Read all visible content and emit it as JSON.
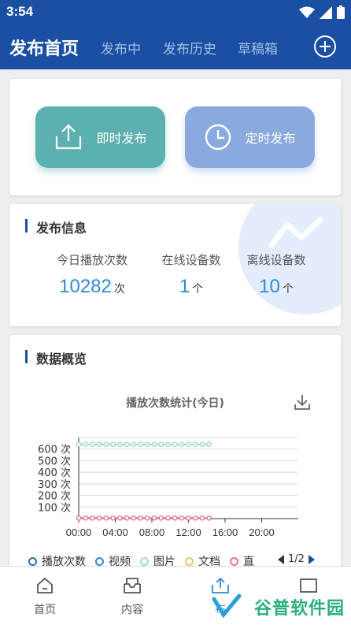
{
  "status_bar": {
    "time": "3:54"
  },
  "app_bar": {
    "title": "发布首页",
    "tabs": [
      {
        "label": "发布中"
      },
      {
        "label": "发布历史"
      },
      {
        "label": "草稿箱"
      }
    ]
  },
  "publish_actions": {
    "now_label": "即时发布",
    "timed_label": "定时发布"
  },
  "publish_info": {
    "title": "发布信息",
    "stats": [
      {
        "label": "今日播放次数",
        "value": "10282",
        "unit": "次"
      },
      {
        "label": "在线设备数",
        "value": "1",
        "unit": "个"
      },
      {
        "label": "离线设备数",
        "value": "10",
        "unit": "个"
      }
    ]
  },
  "data_overview": {
    "title": "数据概览"
  },
  "chart_data": {
    "type": "line",
    "title": "播放次数统计(今日)",
    "x_ticks": [
      "00:00",
      "04:00",
      "08:00",
      "12:00",
      "16:00",
      "20:00"
    ],
    "y_ticks": [
      "100 次",
      "200 次",
      "300 次",
      "400 次",
      "500 次",
      "600 次"
    ],
    "xlim": [
      0,
      24
    ],
    "ylim": [
      0,
      700
    ],
    "grid": true,
    "x": [
      0,
      0.75,
      1.5,
      2.25,
      3,
      3.75,
      4.5,
      5.25,
      6,
      6.75,
      7.5,
      8.25,
      9,
      9.75,
      10.5,
      11.25,
      12,
      12.75,
      13.5,
      14.25
    ],
    "series": [
      {
        "name": "图片",
        "color": "#9fdcc0",
        "values": [
          640,
          640,
          640,
          640,
          640,
          640,
          640,
          640,
          640,
          640,
          640,
          640,
          640,
          640,
          640,
          640,
          640,
          640,
          640,
          640
        ]
      },
      {
        "name": "直播",
        "color": "#e07a8a",
        "values": [
          5,
          5,
          5,
          5,
          5,
          5,
          5,
          5,
          5,
          5,
          5,
          5,
          5,
          5,
          5,
          5,
          5,
          5,
          5,
          5
        ]
      }
    ],
    "legend": {
      "placement": "bottom",
      "items": [
        {
          "name": "播放次数",
          "color": "#2f6fb5"
        },
        {
          "name": "视频",
          "color": "#2f8bd8"
        },
        {
          "name": "图片",
          "color": "#9fdcc0"
        },
        {
          "name": "文档",
          "color": "#e8c86a"
        },
        {
          "name": "直",
          "color": "#e07a8a"
        }
      ],
      "page": "1/2"
    }
  },
  "bottom_nav": {
    "items": [
      {
        "label": "首页",
        "icon": "home-icon"
      },
      {
        "label": "内容",
        "icon": "inbox-icon"
      },
      {
        "label": "布",
        "icon": "upload-icon"
      }
    ]
  },
  "watermark": {
    "text": "谷普软件园"
  },
  "colors": {
    "primary": "#1a4fa3",
    "accent": "#2f8bd8",
    "button_now": "#5cb0b0",
    "button_timed": "#8aaadf"
  }
}
